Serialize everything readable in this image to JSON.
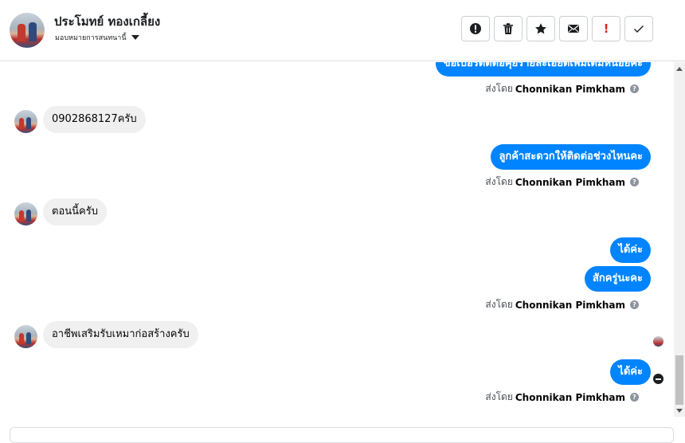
{
  "header": {
    "contact_name": "ประโมทย์ ทองเกลี้ยง",
    "assign_label": "มอบหมายการสนทนานี้"
  },
  "toolbar": [
    {
      "name": "report-spam-button",
      "icon": "alert-circle-icon"
    },
    {
      "name": "delete-button",
      "icon": "trash-icon"
    },
    {
      "name": "star-button",
      "icon": "star-icon"
    },
    {
      "name": "mark-unread-button",
      "icon": "mail-icon"
    },
    {
      "name": "follow-up-button",
      "icon": "exclamation-icon",
      "label": "!"
    },
    {
      "name": "mark-done-button",
      "icon": "check-icon"
    }
  ],
  "messages": {
    "out_1": "ขอเบอร์ติดต่อคุยรายละเอียดเพิ่มเติมหน่อยค่ะ",
    "in_1": "0902868127ครับ",
    "out_2": "ลูกค้าสะดวกให้ติดต่อช่วงไหนคะ",
    "in_2": "ตอนนี้ครับ",
    "out_3": "ได้ค่ะ",
    "out_4": "สักครู่นะคะ",
    "in_3": "อาชีพเสริมรับเหมาก่อสร้างครับ",
    "out_5": "ได้ค่ะ"
  },
  "sent_by": {
    "prefix": "ส่งโดย",
    "agent": "Chonnikan Pimkham",
    "help_glyph": "?"
  },
  "colors": {
    "outgoing_bubble": "#0084ff",
    "incoming_bubble": "#f0f0f0",
    "urgent": "#e02525"
  }
}
